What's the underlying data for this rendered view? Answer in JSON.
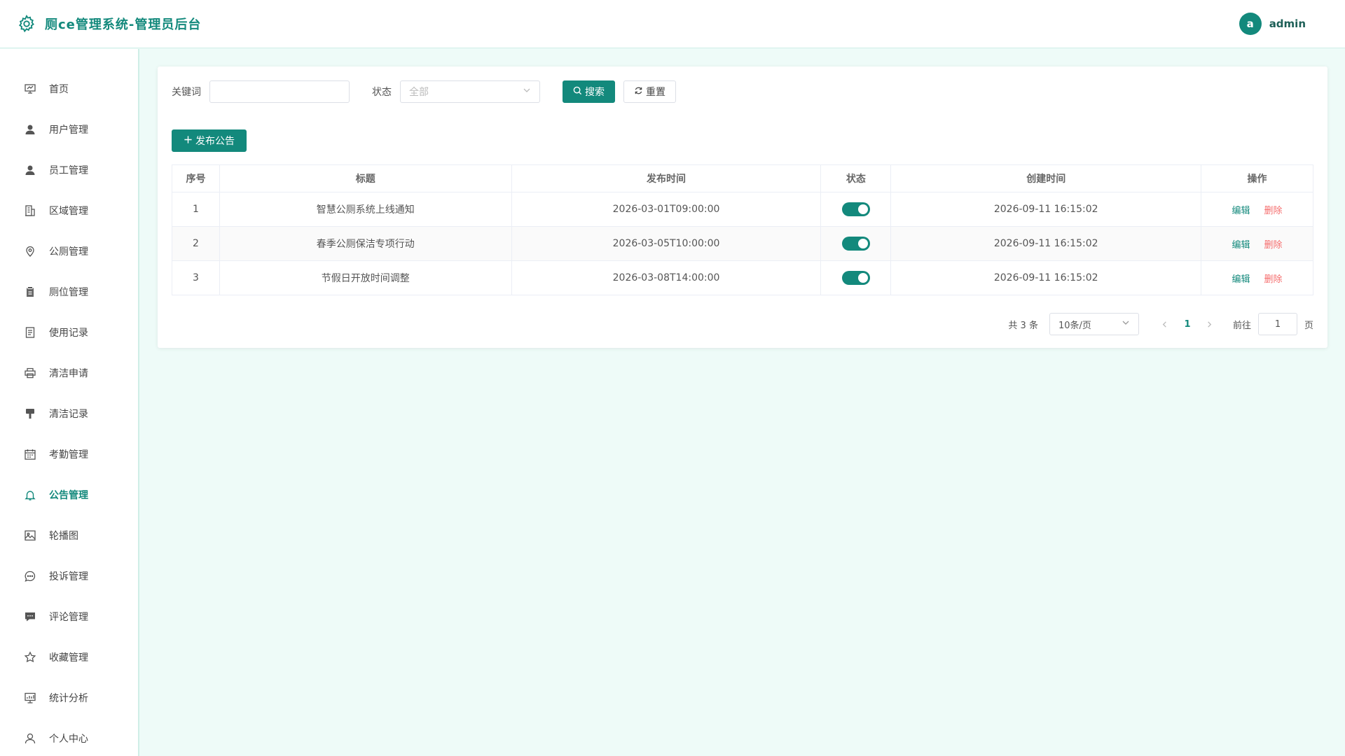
{
  "app": {
    "title": "厕ce管理系统-管理员后台"
  },
  "user": {
    "avatar_letter": "a",
    "name": "admin"
  },
  "colors": {
    "accent": "#13897c",
    "danger": "#f56c6c",
    "background": "#eefbf8"
  },
  "sidebar": {
    "items": [
      {
        "label": "首页",
        "icon": "presentation-icon"
      },
      {
        "label": "用户管理",
        "icon": "user-solid-icon"
      },
      {
        "label": "员工管理",
        "icon": "user-solid-icon"
      },
      {
        "label": "区域管理",
        "icon": "office-building-icon"
      },
      {
        "label": "公厕管理",
        "icon": "location-pin-icon"
      },
      {
        "label": "厕位管理",
        "icon": "clipboard-icon"
      },
      {
        "label": "使用记录",
        "icon": "document-icon"
      },
      {
        "label": "清洁申请",
        "icon": "printer-icon"
      },
      {
        "label": "清洁记录",
        "icon": "brush-icon"
      },
      {
        "label": "考勤管理",
        "icon": "calendar-icon"
      },
      {
        "label": "公告管理",
        "icon": "bell-icon",
        "active": true
      },
      {
        "label": "轮播图",
        "icon": "picture-icon"
      },
      {
        "label": "投诉管理",
        "icon": "chat-round-icon"
      },
      {
        "label": "评论管理",
        "icon": "chat-square-icon"
      },
      {
        "label": "收藏管理",
        "icon": "star-icon"
      },
      {
        "label": "统计分析",
        "icon": "data-board-icon"
      },
      {
        "label": "个人中心",
        "icon": "user-outline-icon"
      }
    ]
  },
  "filters": {
    "keyword_label": "关键词",
    "keyword_value": "",
    "status_label": "状态",
    "status_placeholder": "全部",
    "search_label": "搜索",
    "reset_label": "重置"
  },
  "actions": {
    "publish_label": "发布公告"
  },
  "table": {
    "columns": [
      "序号",
      "标题",
      "发布时间",
      "状态",
      "创建时间",
      "操作"
    ],
    "rows": [
      {
        "index": "1",
        "title": "智慧公厕系统上线通知",
        "publish_time": "2026-03-01T09:00:00",
        "enabled": true,
        "created": "2026-09-11 16:15:02",
        "edit": "编辑",
        "delete": "删除"
      },
      {
        "index": "2",
        "title": "春季公厕保洁专项行动",
        "publish_time": "2026-03-05T10:00:00",
        "enabled": true,
        "created": "2026-09-11 16:15:02",
        "edit": "编辑",
        "delete": "删除"
      },
      {
        "index": "3",
        "title": "节假日开放时间调整",
        "publish_time": "2026-03-08T14:00:00",
        "enabled": true,
        "created": "2026-09-11 16:15:02",
        "edit": "编辑",
        "delete": "删除"
      }
    ]
  },
  "pagination": {
    "total_text": "共 3 条",
    "page_size": "10条/页",
    "current_page": "1",
    "goto_label": "前往",
    "goto_value": "1",
    "goto_suffix": "页"
  }
}
